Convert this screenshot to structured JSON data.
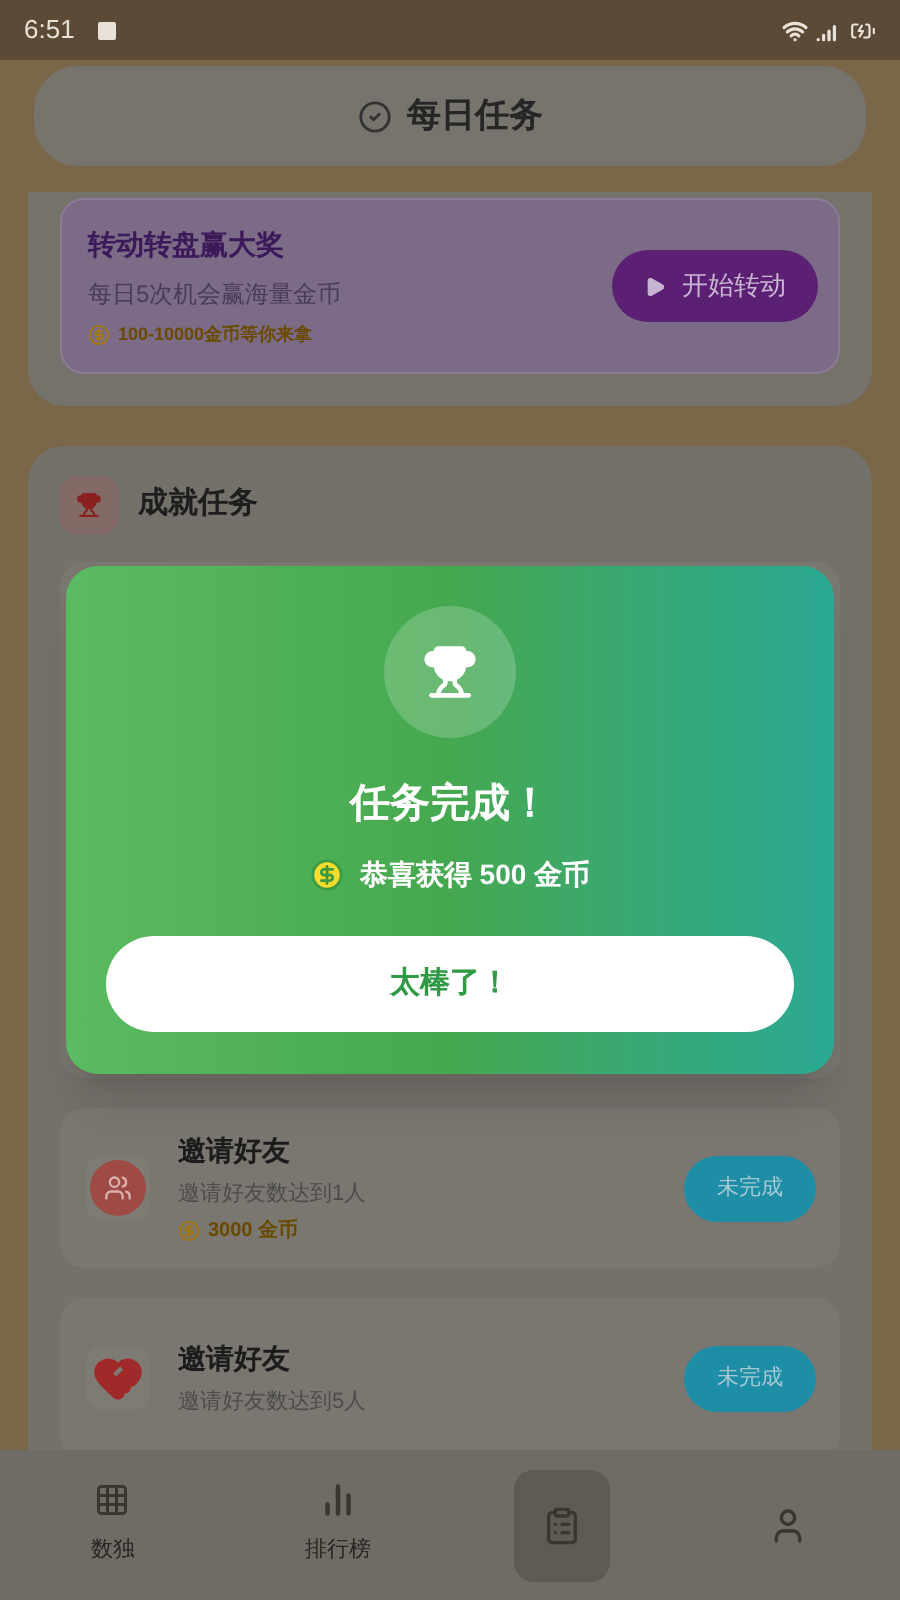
{
  "status_bar": {
    "time": "6:51"
  },
  "header": {
    "title": "每日任务"
  },
  "wheel_banner": {
    "title": "转动转盘赢大奖",
    "subtitle": "每日5次机会赢海量金币",
    "reward": "100-10000金币等你来拿",
    "button": "开始转动"
  },
  "achievements": {
    "title": "成就任务",
    "tasks": [
      {
        "kind": "group",
        "title": "邀请好友",
        "description": "邀请好友数达到1人",
        "reward": "3000 金币",
        "button": "未完成"
      },
      {
        "kind": "hearts",
        "title": "邀请好友",
        "description": "邀请好友数达到5人",
        "button": "未完成"
      }
    ]
  },
  "dialog": {
    "title": "任务完成！",
    "message": "恭喜获得 500 金币",
    "button": "太棒了！"
  },
  "nav": [
    {
      "kind": "grid",
      "label": "数独",
      "selected": false
    },
    {
      "kind": "bars",
      "label": "排行榜",
      "selected": false
    },
    {
      "kind": "clipboard",
      "selected": true
    },
    {
      "kind": "person",
      "selected": false
    }
  ]
}
